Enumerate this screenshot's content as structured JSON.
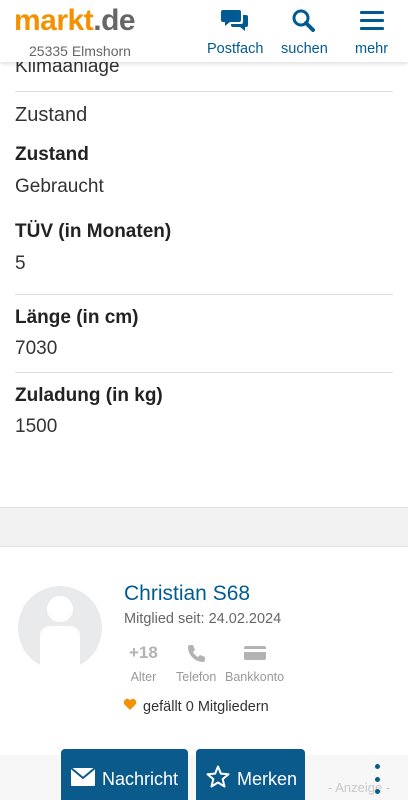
{
  "header": {
    "logo_brand": "markt",
    "logo_dot": ".",
    "logo_tld": "de",
    "location": "25335 Elmshorn",
    "nav": [
      {
        "label": "Postfach",
        "icon": "chat-bubbles-icon"
      },
      {
        "label": "suchen",
        "icon": "search-icon"
      },
      {
        "label": "mehr",
        "icon": "menu-icon"
      }
    ]
  },
  "details": {
    "partial_feature": "Klimaanlage",
    "section_title": "Zustand",
    "fields": [
      {
        "label": "Zustand",
        "value": "Gebraucht"
      },
      {
        "label": "TÜV (in Monaten)",
        "value": "5"
      },
      {
        "label": "Länge (in cm)",
        "value": "7030"
      },
      {
        "label": "Zuladung (in kg)",
        "value": "1500"
      }
    ]
  },
  "seller": {
    "name": "Christian S68",
    "member_since": "Mitglied seit: 24.02.2024",
    "badges": [
      {
        "top": "+18",
        "label": "Alter",
        "icon": ""
      },
      {
        "top": "",
        "label": "Telefon",
        "icon": "phone-icon"
      },
      {
        "top": "",
        "label": "Bankkonto",
        "icon": "credit-card-icon"
      }
    ],
    "likes": "gefällt 0 Mitgliedern"
  },
  "actions": {
    "message_label": "Nachricht",
    "save_label": "Merken",
    "ad_label": "- Anzeige -"
  },
  "colors": {
    "brand_orange": "#f39200",
    "link_blue": "#005b94",
    "button_blue": "#0a5a8c",
    "heart": "#f39200"
  }
}
